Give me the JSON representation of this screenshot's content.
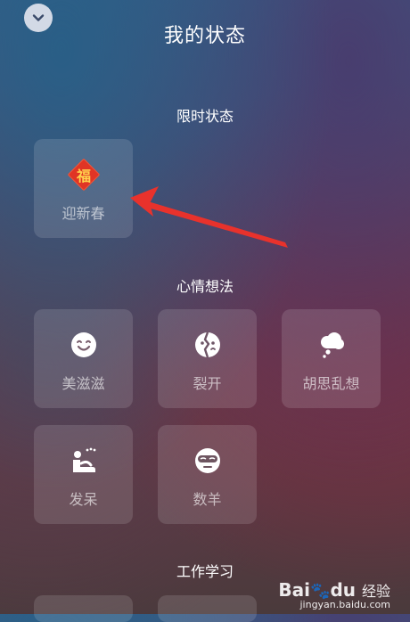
{
  "header": {
    "title": "我的状态"
  },
  "sections": [
    {
      "title": "限时状态",
      "items": [
        {
          "label": "迎新春",
          "icon": "fu-icon"
        }
      ]
    },
    {
      "title": "心情想法",
      "items": [
        {
          "label": "美滋滋",
          "icon": "smile-icon"
        },
        {
          "label": "裂开",
          "icon": "cracked-face-icon"
        },
        {
          "label": "胡思乱想",
          "icon": "thought-cloud-icon"
        },
        {
          "label": "发呆",
          "icon": "dazed-person-icon"
        },
        {
          "label": "数羊",
          "icon": "sleep-mask-icon"
        }
      ]
    },
    {
      "title": "工作学习",
      "items": []
    }
  ],
  "fu_character": "福",
  "watermark": {
    "brand": "Bai",
    "brand_suffix": "du",
    "experience": "经验",
    "url": "jingyan.baidu.com"
  },
  "colors": {
    "fu_red": "#e03525",
    "fu_gold": "#ffd34d",
    "arrow_red": "#e8322c"
  }
}
